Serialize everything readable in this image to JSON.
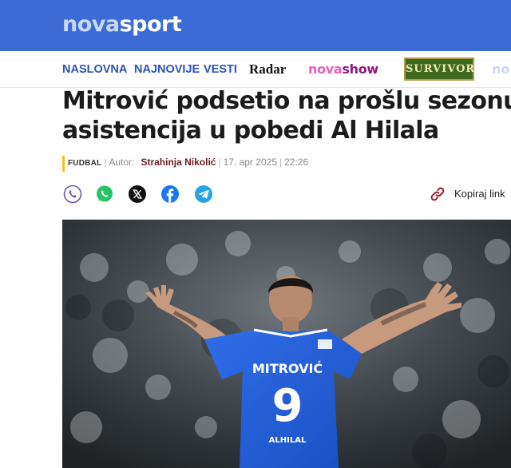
{
  "brand": {
    "logo_part1": "nova",
    "logo_part2": "sport"
  },
  "nav": {
    "items": [
      "NASLOVNA",
      "NAJNOVIJE",
      "VESTI"
    ],
    "radar": "Radar",
    "novashow_part1": "nova",
    "novashow_part2": "show",
    "survivor": "SURVIVOR",
    "cut": "no"
  },
  "article": {
    "headline_line1": "Mitrović podsetio na prošlu sezonu,",
    "headline_line2": "asistencija u pobedi Al Hilala",
    "category": "FUDBAL",
    "author_label": "Autor:",
    "author": "Strahinja Nikolić",
    "date": "17. apr 2025",
    "time": "22:26"
  },
  "share": {
    "icons": [
      "viber-icon",
      "whatsapp-icon",
      "x-icon",
      "facebook-icon",
      "telegram-icon"
    ],
    "copy_label": "Kopiraj link"
  },
  "hero_image": {
    "jersey_name": "MITROVIĆ",
    "jersey_number": "9",
    "sponsor": "ALHILAL"
  },
  "colors": {
    "header_blue": "#3c6bd6",
    "nav_blue": "#2a53b8",
    "category_accent": "#f3c21b",
    "author_color": "#6b1e1e"
  }
}
